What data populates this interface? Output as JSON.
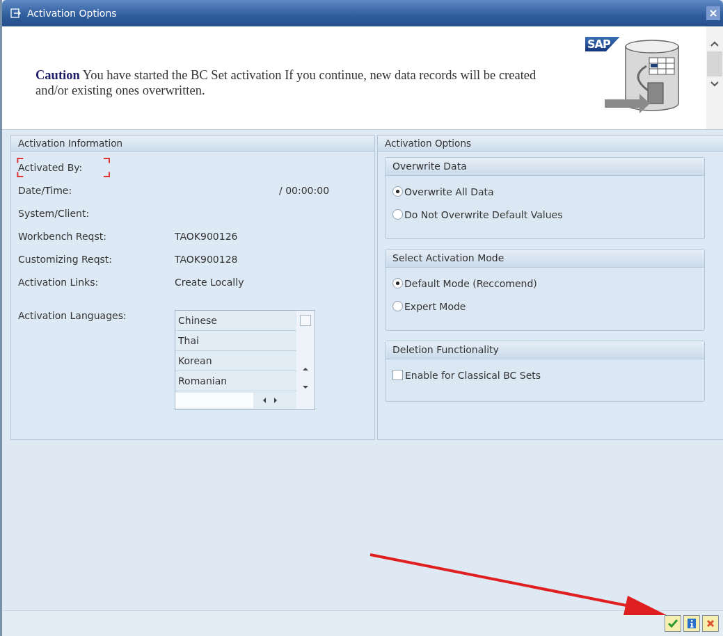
{
  "window": {
    "title": "Activation Options"
  },
  "header": {
    "message": "**Caution** You have started the BC Set activation If you continue, new data records will be created and/or existing ones overwritten.",
    "logo_text": "SAP"
  },
  "info_panel": {
    "title": "Activation Information",
    "rows": [
      {
        "kind": "text",
        "label": "Activated By:",
        "value": "",
        "focused": true
      },
      {
        "kind": "datetime",
        "label": "Date/Time:",
        "value": "/  00:00:00",
        "focused": false
      },
      {
        "kind": "text",
        "label": "System/Client:",
        "value": "",
        "focused": false
      },
      {
        "kind": "text",
        "label": "Workbench Reqst:",
        "value": "TAOK900126",
        "focused": false
      },
      {
        "kind": "text",
        "label": "Customizing Reqst:",
        "value": "TAOK900128",
        "focused": false
      },
      {
        "kind": "text",
        "label": "Activation Links:",
        "value": "Create Locally",
        "focused": false
      }
    ],
    "languages_label": "Activation Languages:",
    "languages": [
      "Chinese",
      "Thai",
      "Korean",
      "Romanian"
    ]
  },
  "options_panel": {
    "title": "Activation Options",
    "groups": [
      {
        "title": "Overwrite Data",
        "options": [
          {
            "kind": "radio",
            "label": "Overwrite All Data",
            "selected": true
          },
          {
            "kind": "radio",
            "label": "Do Not Overwrite Default Values",
            "selected": false
          }
        ]
      },
      {
        "title": "Select Activation Mode",
        "options": [
          {
            "kind": "radio",
            "label": "Default Mode (Reccomend)",
            "selected": true
          },
          {
            "kind": "radio",
            "label": "Expert Mode",
            "selected": false
          }
        ]
      },
      {
        "title": "Deletion Functionality",
        "options": [
          {
            "kind": "checkbox",
            "label": "Enable for Classical BC Sets",
            "checked": false
          }
        ]
      }
    ]
  },
  "footer": {
    "buttons": [
      {
        "kind": "confirm"
      },
      {
        "kind": "info"
      },
      {
        "kind": "cancel"
      }
    ]
  }
}
